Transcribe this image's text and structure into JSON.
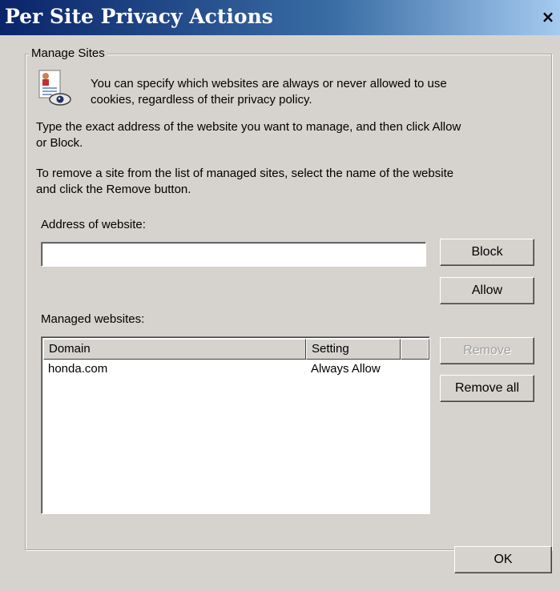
{
  "window": {
    "title": "Per Site Privacy Actions",
    "close_glyph": "×"
  },
  "manage_sites": {
    "legend": "Manage Sites",
    "icon": "privacy-eye-document-icon",
    "intro_line1": "You can specify which websites are always or never allowed to use",
    "intro_line2": "cookies, regardless of their privacy policy.",
    "instruction1_line1": "Type the exact address of the website you want to manage, and then click Allow",
    "instruction1_line2": "or Block.",
    "instruction2_line1": "To remove a site from the list of managed sites, select the name of the website",
    "instruction2_line2": "and click the Remove button.",
    "address_label": "Address of website:",
    "address_value": "",
    "block_label": "Block",
    "allow_label": "Allow",
    "managed_label": "Managed websites:",
    "columns": [
      "Domain",
      "Setting",
      ""
    ],
    "rows": [
      {
        "domain": "honda.com",
        "setting": "Always Allow"
      }
    ],
    "remove_label": "Remove",
    "remove_all_label": "Remove all"
  },
  "footer": {
    "ok_label": "OK"
  }
}
